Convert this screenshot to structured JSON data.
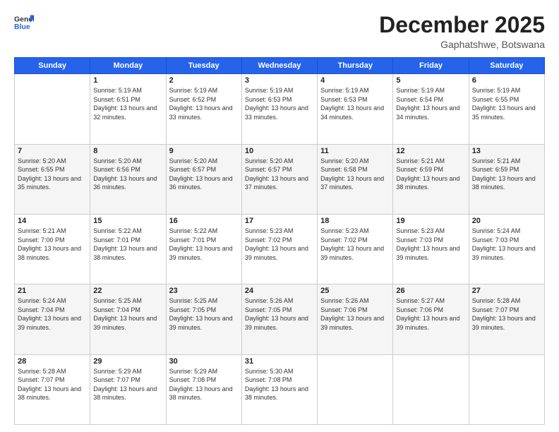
{
  "logo": {
    "general": "General",
    "blue": "Blue"
  },
  "header": {
    "month": "December 2025",
    "location": "Gaphatshwe, Botswana"
  },
  "weekdays": [
    "Sunday",
    "Monday",
    "Tuesday",
    "Wednesday",
    "Thursday",
    "Friday",
    "Saturday"
  ],
  "weeks": [
    [
      {
        "day": "",
        "empty": true
      },
      {
        "day": "1",
        "sunrise": "5:19 AM",
        "sunset": "6:51 PM",
        "daylight": "13 hours and 32 minutes."
      },
      {
        "day": "2",
        "sunrise": "5:19 AM",
        "sunset": "6:52 PM",
        "daylight": "13 hours and 33 minutes."
      },
      {
        "day": "3",
        "sunrise": "5:19 AM",
        "sunset": "6:53 PM",
        "daylight": "13 hours and 33 minutes."
      },
      {
        "day": "4",
        "sunrise": "5:19 AM",
        "sunset": "6:53 PM",
        "daylight": "13 hours and 34 minutes."
      },
      {
        "day": "5",
        "sunrise": "5:19 AM",
        "sunset": "6:54 PM",
        "daylight": "13 hours and 34 minutes."
      },
      {
        "day": "6",
        "sunrise": "5:19 AM",
        "sunset": "6:55 PM",
        "daylight": "13 hours and 35 minutes."
      }
    ],
    [
      {
        "day": "7",
        "sunrise": "5:20 AM",
        "sunset": "6:55 PM",
        "daylight": "13 hours and 35 minutes."
      },
      {
        "day": "8",
        "sunrise": "5:20 AM",
        "sunset": "6:56 PM",
        "daylight": "13 hours and 36 minutes."
      },
      {
        "day": "9",
        "sunrise": "5:20 AM",
        "sunset": "6:57 PM",
        "daylight": "13 hours and 36 minutes."
      },
      {
        "day": "10",
        "sunrise": "5:20 AM",
        "sunset": "6:57 PM",
        "daylight": "13 hours and 37 minutes."
      },
      {
        "day": "11",
        "sunrise": "5:20 AM",
        "sunset": "6:58 PM",
        "daylight": "13 hours and 37 minutes."
      },
      {
        "day": "12",
        "sunrise": "5:21 AM",
        "sunset": "6:59 PM",
        "daylight": "13 hours and 38 minutes."
      },
      {
        "day": "13",
        "sunrise": "5:21 AM",
        "sunset": "6:59 PM",
        "daylight": "13 hours and 38 minutes."
      }
    ],
    [
      {
        "day": "14",
        "sunrise": "5:21 AM",
        "sunset": "7:00 PM",
        "daylight": "13 hours and 38 minutes."
      },
      {
        "day": "15",
        "sunrise": "5:22 AM",
        "sunset": "7:01 PM",
        "daylight": "13 hours and 38 minutes."
      },
      {
        "day": "16",
        "sunrise": "5:22 AM",
        "sunset": "7:01 PM",
        "daylight": "13 hours and 39 minutes."
      },
      {
        "day": "17",
        "sunrise": "5:23 AM",
        "sunset": "7:02 PM",
        "daylight": "13 hours and 39 minutes."
      },
      {
        "day": "18",
        "sunrise": "5:23 AM",
        "sunset": "7:02 PM",
        "daylight": "13 hours and 39 minutes."
      },
      {
        "day": "19",
        "sunrise": "5:23 AM",
        "sunset": "7:03 PM",
        "daylight": "13 hours and 39 minutes."
      },
      {
        "day": "20",
        "sunrise": "5:24 AM",
        "sunset": "7:03 PM",
        "daylight": "13 hours and 39 minutes."
      }
    ],
    [
      {
        "day": "21",
        "sunrise": "5:24 AM",
        "sunset": "7:04 PM",
        "daylight": "13 hours and 39 minutes."
      },
      {
        "day": "22",
        "sunrise": "5:25 AM",
        "sunset": "7:04 PM",
        "daylight": "13 hours and 39 minutes."
      },
      {
        "day": "23",
        "sunrise": "5:25 AM",
        "sunset": "7:05 PM",
        "daylight": "13 hours and 39 minutes."
      },
      {
        "day": "24",
        "sunrise": "5:26 AM",
        "sunset": "7:05 PM",
        "daylight": "13 hours and 39 minutes."
      },
      {
        "day": "25",
        "sunrise": "5:26 AM",
        "sunset": "7:06 PM",
        "daylight": "13 hours and 39 minutes."
      },
      {
        "day": "26",
        "sunrise": "5:27 AM",
        "sunset": "7:06 PM",
        "daylight": "13 hours and 39 minutes."
      },
      {
        "day": "27",
        "sunrise": "5:28 AM",
        "sunset": "7:07 PM",
        "daylight": "13 hours and 39 minutes."
      }
    ],
    [
      {
        "day": "28",
        "sunrise": "5:28 AM",
        "sunset": "7:07 PM",
        "daylight": "13 hours and 38 minutes."
      },
      {
        "day": "29",
        "sunrise": "5:29 AM",
        "sunset": "7:07 PM",
        "daylight": "13 hours and 38 minutes."
      },
      {
        "day": "30",
        "sunrise": "5:29 AM",
        "sunset": "7:08 PM",
        "daylight": "13 hours and 38 minutes."
      },
      {
        "day": "31",
        "sunrise": "5:30 AM",
        "sunset": "7:08 PM",
        "daylight": "13 hours and 38 minutes."
      },
      {
        "day": "",
        "empty": true
      },
      {
        "day": "",
        "empty": true
      },
      {
        "day": "",
        "empty": true
      }
    ]
  ]
}
